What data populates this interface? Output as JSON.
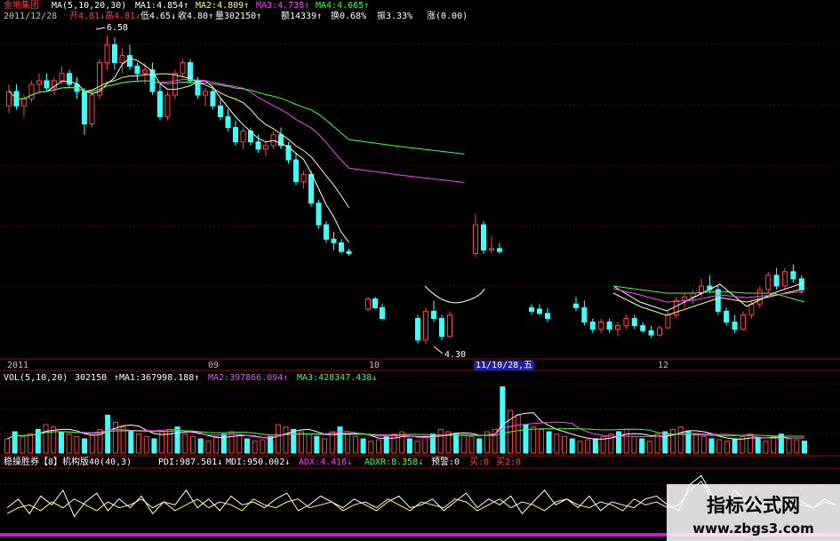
{
  "header": {
    "stock_name": "金地集团",
    "ma_label": "MA(5,10,20,30)",
    "ma1": "MA1:4.854↑",
    "ma2": "MA2:4.809↑",
    "ma3": "MA3:4.738↑",
    "ma4": "MA4:4.665↑",
    "date": "2011/12/28",
    "open": "开4.81↓",
    "high": "高4.81↓",
    "low": "低4.65↓",
    "close": "收4.80↑",
    "volume": "量302150↑",
    "amount": "额14339↑",
    "turnover": "换0.68%",
    "amplitude": "振3.33%",
    "change": "涨(0.00)"
  },
  "vol_header": {
    "label": "VOL(5,10,20)",
    "value": "302150",
    "ma1": "↑MA1:367998.188↑",
    "ma2": "MA2:397866.094↑",
    "ma3": "MA3:428347.438↓"
  },
  "ind_header": {
    "text1": "稳操胜券【8】机构版40(40,3)",
    "pdi": "PDI:987.501↓",
    "mdi": "MDI:950.002↓",
    "adx": "ADX:4.416↓",
    "adxr": "ADXR:8.358↓",
    "warn": "预警:0",
    "buy1": "买:0",
    "buy2": "买2:0"
  },
  "axis": {
    "t0": "2011",
    "t1": "09",
    "t2": "10",
    "t3": "11/10/28,五",
    "t4": "12"
  },
  "annot": {
    "high": "6.58",
    "low": "4.30"
  },
  "watermark": {
    "line1": "指标公式网",
    "line2": "www.zbgs3.com"
  },
  "colors": {
    "up": "#ff4040",
    "down": "#40ffff",
    "ma1": "#ffffff",
    "ma2": "#ffff80",
    "ma3": "#ff40ff",
    "ma4": "#40ff40"
  },
  "chart_data": {
    "type": "candlestick",
    "y_ticks_hint": [
      4.3,
      6.58
    ],
    "candles": [
      [
        5.6,
        5.9,
        5.5,
        5.8
      ],
      [
        5.8,
        5.9,
        5.55,
        5.6
      ],
      [
        5.6,
        5.75,
        5.45,
        5.7
      ],
      [
        5.7,
        5.95,
        5.65,
        5.9
      ],
      [
        5.9,
        6.05,
        5.8,
        5.95
      ],
      [
        5.95,
        6.05,
        5.8,
        5.85
      ],
      [
        5.85,
        6.0,
        5.75,
        5.95
      ],
      [
        5.95,
        6.15,
        5.9,
        6.05
      ],
      [
        6.05,
        6.1,
        5.85,
        5.9
      ],
      [
        5.9,
        6.0,
        5.7,
        5.8
      ],
      [
        5.8,
        5.85,
        5.2,
        5.35
      ],
      [
        5.35,
        5.8,
        5.3,
        5.75
      ],
      [
        5.75,
        6.25,
        5.7,
        6.2
      ],
      [
        6.2,
        6.58,
        6.1,
        6.45
      ],
      [
        6.45,
        6.55,
        6.1,
        6.2
      ],
      [
        6.2,
        6.4,
        6.05,
        6.3
      ],
      [
        6.3,
        6.45,
        6.1,
        6.15
      ],
      [
        6.15,
        6.2,
        5.95,
        6.05
      ],
      [
        6.05,
        6.2,
        5.9,
        6.1
      ],
      [
        6.1,
        6.2,
        5.75,
        5.8
      ],
      [
        5.8,
        5.9,
        5.4,
        5.45
      ],
      [
        5.45,
        5.8,
        5.4,
        5.75
      ],
      [
        5.75,
        6.1,
        5.7,
        6.05
      ],
      [
        6.05,
        6.25,
        6.0,
        6.2
      ],
      [
        6.2,
        6.25,
        5.9,
        5.95
      ],
      [
        5.95,
        6.0,
        5.7,
        5.75
      ],
      [
        5.75,
        5.85,
        5.6,
        5.8
      ],
      [
        5.8,
        5.85,
        5.55,
        5.6
      ],
      [
        5.6,
        5.7,
        5.4,
        5.45
      ],
      [
        5.45,
        5.55,
        5.25,
        5.3
      ],
      [
        5.3,
        5.4,
        5.05,
        5.1
      ],
      [
        5.1,
        5.3,
        5.0,
        5.25
      ],
      [
        5.25,
        5.3,
        5.05,
        5.1
      ],
      [
        5.1,
        5.2,
        4.95,
        5.0
      ],
      [
        5.0,
        5.1,
        4.9,
        5.05
      ],
      [
        5.05,
        5.25,
        5.0,
        5.2
      ],
      [
        5.2,
        5.3,
        5.0,
        5.05
      ],
      [
        5.05,
        5.1,
        4.8,
        4.85
      ],
      [
        4.85,
        4.95,
        4.5,
        4.55
      ],
      [
        4.55,
        4.7,
        4.45,
        4.65
      ],
      [
        4.65,
        4.7,
        4.2,
        4.25
      ],
      [
        4.25,
        4.3,
        3.9,
        3.95
      ],
      [
        3.95,
        4.0,
        3.7,
        3.75
      ],
      [
        3.75,
        3.85,
        3.6,
        3.7
      ],
      [
        3.7,
        3.75,
        3.55,
        3.58
      ],
      [
        3.58,
        3.62,
        3.52,
        3.55
      ]
    ],
    "gap_candles": [
      [
        2.78,
        2.95,
        2.75,
        2.92
      ],
      [
        2.92,
        2.95,
        2.78,
        2.8
      ],
      [
        2.8,
        2.85,
        2.62,
        2.65
      ],
      [
        2.65,
        2.7,
        2.3,
        2.35
      ],
      [
        2.35,
        2.8,
        2.3,
        2.75
      ],
      [
        2.75,
        2.9,
        2.6,
        2.65
      ],
      [
        2.65,
        2.7,
        2.35,
        2.4
      ],
      [
        2.4,
        2.75,
        2.38,
        2.7
      ]
    ],
    "right_candles": [
      [
        3.55,
        4.1,
        3.5,
        3.95
      ],
      [
        3.95,
        4.0,
        3.55,
        3.6
      ],
      [
        3.6,
        3.8,
        3.55,
        3.62
      ],
      [
        3.62,
        3.7,
        3.55,
        3.58
      ],
      [
        2.8,
        2.85,
        2.7,
        2.75
      ],
      [
        2.78,
        2.85,
        2.7,
        2.72
      ],
      [
        2.72,
        2.8,
        2.6,
        2.65
      ],
      [
        2.85,
        2.95,
        2.75,
        2.8
      ],
      [
        2.8,
        2.9,
        2.55,
        2.6
      ],
      [
        2.6,
        2.65,
        2.45,
        2.5
      ],
      [
        2.5,
        2.65,
        2.45,
        2.6
      ],
      [
        2.6,
        2.65,
        2.45,
        2.5
      ],
      [
        2.5,
        2.6,
        2.4,
        2.55
      ],
      [
        2.55,
        2.7,
        2.5,
        2.65
      ],
      [
        2.65,
        2.7,
        2.5,
        2.55
      ],
      [
        2.55,
        2.6,
        2.45,
        2.48
      ],
      [
        2.48,
        2.55,
        2.38,
        2.42
      ],
      [
        2.42,
        2.55,
        2.4,
        2.52
      ],
      [
        2.52,
        2.75,
        2.5,
        2.7
      ],
      [
        2.7,
        2.95,
        2.65,
        2.9
      ],
      [
        2.9,
        3.0,
        2.8,
        2.95
      ],
      [
        2.95,
        3.05,
        2.85,
        3.0
      ],
      [
        3.0,
        3.2,
        2.95,
        3.1
      ],
      [
        3.1,
        3.25,
        3.0,
        3.05
      ],
      [
        3.05,
        3.1,
        2.7,
        2.75
      ],
      [
        2.75,
        2.8,
        2.55,
        2.6
      ],
      [
        2.6,
        2.7,
        2.45,
        2.5
      ],
      [
        2.5,
        2.75,
        2.48,
        2.7
      ],
      [
        2.7,
        2.9,
        2.65,
        2.85
      ],
      [
        2.85,
        3.1,
        2.8,
        3.05
      ],
      [
        3.05,
        3.3,
        3.0,
        3.25
      ],
      [
        3.25,
        3.35,
        3.05,
        3.1
      ],
      [
        3.1,
        3.35,
        3.05,
        3.3
      ],
      [
        3.3,
        3.4,
        3.15,
        3.2
      ],
      [
        3.2,
        3.25,
        3.0,
        3.05
      ]
    ],
    "volume": [
      30,
      45,
      35,
      40,
      50,
      60,
      55,
      45,
      40,
      35,
      30,
      38,
      50,
      80,
      65,
      55,
      45,
      40,
      35,
      30,
      45,
      50,
      55,
      40,
      35,
      30,
      25,
      35,
      40,
      45,
      38,
      30,
      25,
      28,
      35,
      60,
      55,
      50,
      45,
      40,
      35,
      30,
      45,
      55,
      40,
      35,
      30,
      25,
      28,
      35,
      40,
      45,
      30,
      25,
      35,
      40,
      50,
      45,
      40,
      38,
      35,
      30,
      45,
      50,
      140,
      90,
      80,
      60,
      55,
      50,
      45,
      40,
      35,
      30,
      25,
      28,
      30,
      35,
      40,
      45,
      50,
      35,
      30,
      25,
      40,
      45,
      50,
      55,
      45,
      40,
      35,
      30,
      28,
      25,
      30,
      35,
      40,
      30,
      25,
      35,
      40,
      30,
      28,
      25
    ],
    "indicator1": [
      40,
      55,
      30,
      60,
      45,
      70,
      25,
      50,
      65,
      35,
      55,
      40,
      60,
      30,
      50,
      45,
      70,
      40,
      55,
      35,
      60,
      45,
      50,
      40,
      55,
      65,
      35,
      45,
      60,
      50,
      40,
      55,
      45,
      35,
      50,
      60,
      40,
      45,
      55,
      35,
      50,
      65,
      40,
      55,
      45,
      60,
      30,
      50,
      70,
      45,
      55,
      40,
      60,
      35,
      50,
      45,
      40,
      55,
      60,
      45,
      35,
      80,
      95,
      60,
      45,
      70,
      50,
      40,
      55,
      45,
      60,
      50,
      40,
      55,
      45
    ],
    "indicator2": [
      30,
      40,
      45,
      35,
      50,
      40,
      55,
      45,
      35,
      50,
      40,
      45,
      55,
      40,
      50,
      35,
      45,
      55,
      40,
      50,
      45,
      35,
      55,
      45,
      40,
      50,
      55,
      40,
      45,
      50,
      35,
      45,
      50,
      40,
      55,
      45,
      35,
      50,
      45,
      40,
      55,
      50,
      35,
      45,
      55,
      40,
      50,
      45,
      35,
      50,
      55,
      45,
      40,
      50,
      45,
      35,
      55,
      45,
      50,
      40,
      45,
      70,
      85,
      55,
      50,
      60,
      45,
      50,
      40,
      55,
      50,
      45,
      40,
      50,
      45
    ]
  }
}
